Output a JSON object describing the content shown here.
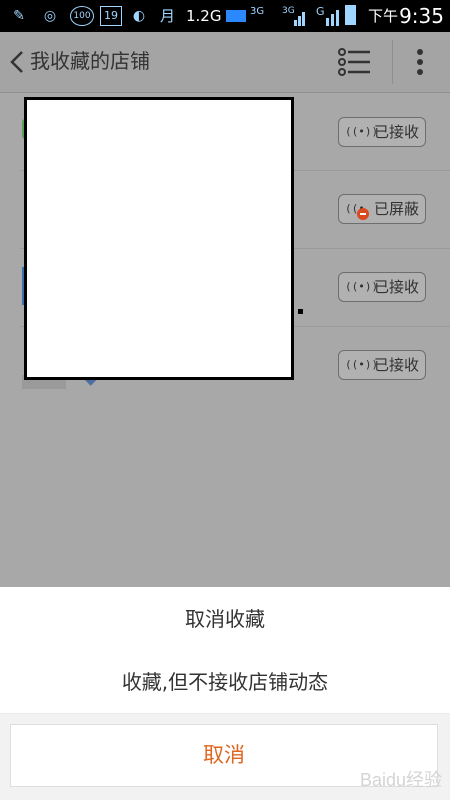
{
  "statusbar": {
    "notif_calendar": "19",
    "notif_count": "100",
    "notif_month": "月",
    "net_speed": "1.2G",
    "net_type_1": "3G",
    "net_type_2": "3G",
    "net_type_3": "G",
    "period": "下午",
    "time": "9:35",
    "icons": [
      "broom-icon",
      "chat-icon",
      "badge-100-icon",
      "calendar-icon",
      "pointer-icon",
      "battery-icon",
      "signal-icon"
    ]
  },
  "header": {
    "title": "我收藏的店铺",
    "back_icon": "chevron-left-icon",
    "list_icon": "list-icon",
    "more_icon": "more-vertical-icon"
  },
  "stores": [
    {
      "status_label": "已接收",
      "status_icon": "broadcast-icon"
    },
    {
      "status_label": "已屏蔽",
      "status_icon": "broadcast-blocked-icon"
    },
    {
      "status_label": "已接收",
      "status_icon": "broadcast-icon"
    },
    {
      "status_label": "已接收",
      "status_icon": "broadcast-icon"
    }
  ],
  "sheet": {
    "option_unfavorite": "取消收藏",
    "option_no_updates": "收藏,但不接收店铺动态",
    "cancel_label": "取消"
  },
  "watermark": "Baidu经验",
  "colors": {
    "accent": "#e0661f",
    "overlay": "#a8a8a8",
    "statusbar": "#000000"
  }
}
